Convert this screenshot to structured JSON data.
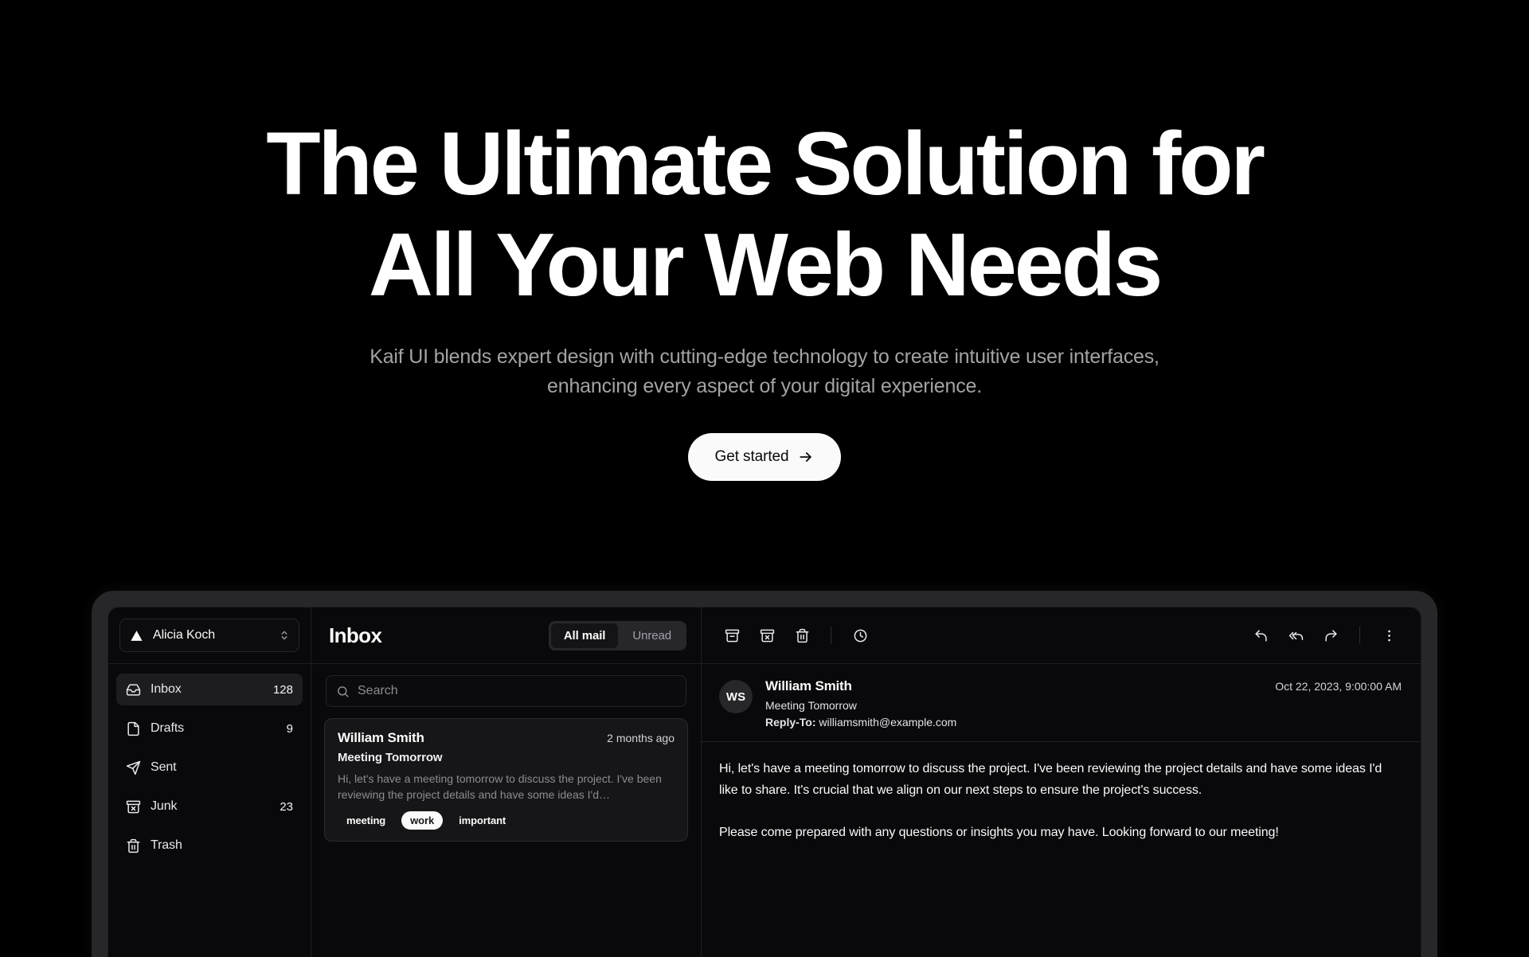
{
  "hero": {
    "title_line1": "The Ultimate Solution for",
    "title_line2": "All Your Web Needs",
    "subtitle": "Kaif UI blends expert design with cutting-edge technology to create intuitive user interfaces, enhancing every aspect of your digital experience.",
    "cta_label": "Get started"
  },
  "colors": {
    "background": "#000000",
    "text_primary": "#ffffff",
    "text_muted": "#a3a3a3",
    "cta_background": "#fafafa",
    "cta_text": "#0a0a0a",
    "device_bezel": "#27272a",
    "app_background": "#09090b",
    "border": "#1f1f22",
    "active_item": "#1d1d20"
  },
  "mail_app": {
    "sidebar": {
      "account": {
        "name": "Alicia Koch",
        "icon": "triangle-logo-icon",
        "chevron": "chevron-up-down-icon"
      },
      "items": [
        {
          "label": "Inbox",
          "count": "128",
          "icon": "inbox-icon",
          "active": true
        },
        {
          "label": "Drafts",
          "count": "9",
          "icon": "file-icon",
          "active": false
        },
        {
          "label": "Sent",
          "count": "",
          "icon": "send-icon",
          "active": false
        },
        {
          "label": "Junk",
          "count": "23",
          "icon": "archive-x-icon",
          "active": false
        },
        {
          "label": "Trash",
          "count": "",
          "icon": "trash-icon",
          "active": false
        }
      ]
    },
    "list": {
      "title": "Inbox",
      "tabs": [
        {
          "label": "All mail",
          "active": true
        },
        {
          "label": "Unread",
          "active": false
        }
      ],
      "search_placeholder": "Search",
      "search_value": "",
      "search_icon": "search-icon",
      "messages": [
        {
          "sender": "William Smith",
          "time": "2 months ago",
          "subject": "Meeting Tomorrow",
          "preview": "Hi, let's have a meeting tomorrow to discuss the project. I've been reviewing the project details and have some ideas I'd…",
          "tags": [
            {
              "label": "meeting",
              "solid": false
            },
            {
              "label": "work",
              "solid": true
            },
            {
              "label": "important",
              "solid": false
            }
          ]
        }
      ]
    },
    "view": {
      "toolbar_left": [
        {
          "icon": "archive-icon",
          "name": "archive-button"
        },
        {
          "icon": "archive-x-icon",
          "name": "move-to-junk-button"
        },
        {
          "icon": "trash-icon",
          "name": "move-to-trash-button"
        },
        {
          "icon": "clock-icon",
          "name": "snooze-button"
        }
      ],
      "toolbar_right": [
        {
          "icon": "reply-icon",
          "name": "reply-button"
        },
        {
          "icon": "reply-all-icon",
          "name": "reply-all-button"
        },
        {
          "icon": "forward-icon",
          "name": "forward-button"
        },
        {
          "icon": "more-vertical-icon",
          "name": "more-options-button"
        }
      ],
      "message": {
        "avatar_initials": "WS",
        "from": "William Smith",
        "subject": "Meeting Tomorrow",
        "reply_to_label": "Reply-To:",
        "reply_to_email": "williamsmith@example.com",
        "date": "Oct 22, 2023, 9:00:00 AM",
        "body_paragraph_1": "Hi, let's have a meeting tomorrow to discuss the project. I've been reviewing the project details and have some ideas I'd like to share. It's crucial that we align on our next steps to ensure the project's success.",
        "body_paragraph_2": "Please come prepared with any questions or insights you may have. Looking forward to our meeting!"
      }
    }
  }
}
